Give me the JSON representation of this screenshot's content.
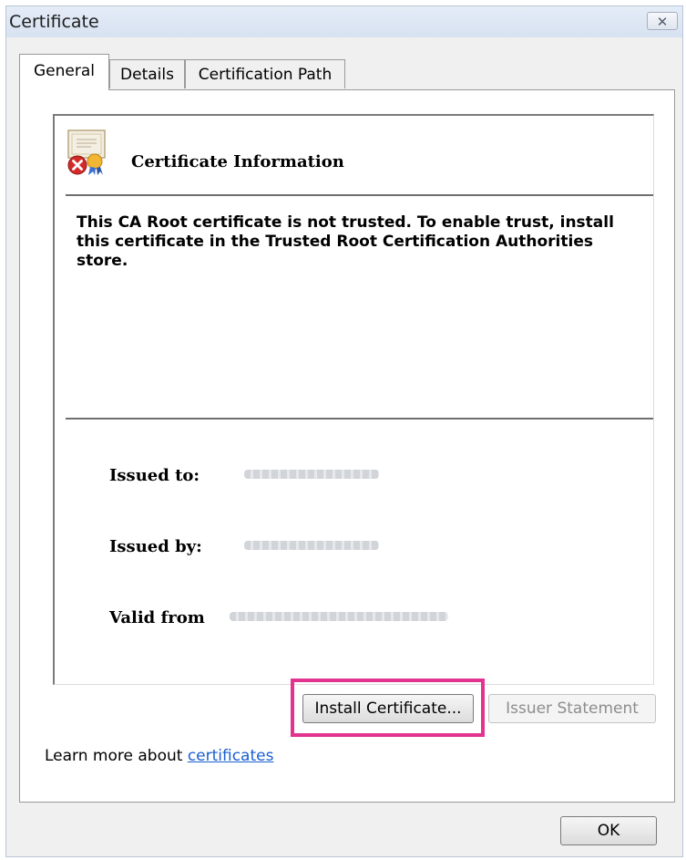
{
  "window": {
    "title": "Certificate"
  },
  "tabs": [
    {
      "label": "General"
    },
    {
      "label": "Details"
    },
    {
      "label": "Certification Path"
    }
  ],
  "info": {
    "title": "Certificate Information",
    "warning": "This CA Root certificate is not trusted. To enable trust, install this certificate in the Trusted Root Certification Authorities store."
  },
  "fields": {
    "issued_to_label": "Issued to:",
    "issued_by_label": "Issued by:",
    "valid_from_label": "Valid from"
  },
  "buttons": {
    "install": "Install Certificate...",
    "issuer_statement": "Issuer Statement",
    "ok": "OK"
  },
  "footer": {
    "learn_prefix": "Learn more about ",
    "learn_link": "certificates"
  },
  "colors": {
    "highlight": "#e2338f",
    "link": "#1a5fd1"
  }
}
